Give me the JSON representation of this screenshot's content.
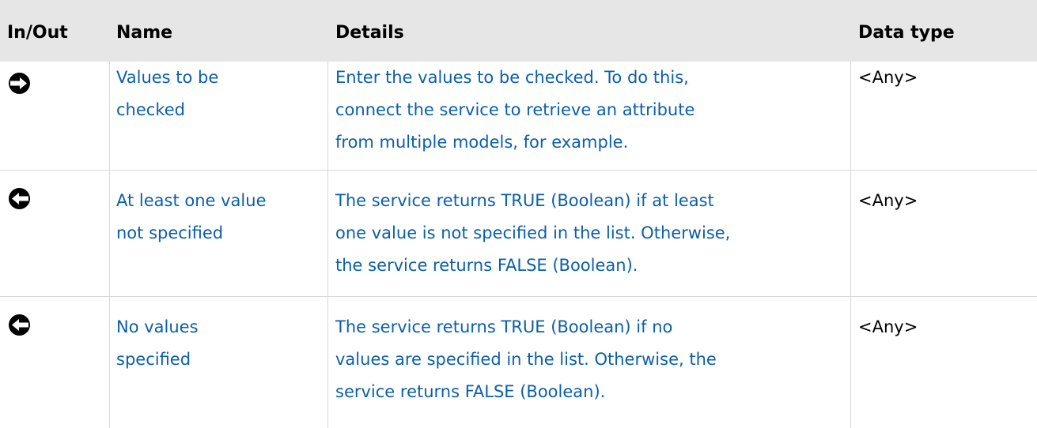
{
  "table": {
    "headers": {
      "inout": "In/Out",
      "name": "Name",
      "details": "Details",
      "datatype": "Data type"
    },
    "rows": [
      {
        "direction": "input",
        "icon": "input-arrow-icon",
        "name_line1": "Values to be",
        "name_line2": "checked",
        "details_line1": "Enter the values to be checked. To do this,",
        "details_line2": "connect the service to retrieve an attribute",
        "details_line3": "from multiple models, for example.",
        "datatype": "<Any>"
      },
      {
        "direction": "output",
        "icon": "output-arrow-icon",
        "name_line1": "At least one value",
        "name_line2": "not specified",
        "details_line1": "The service returns TRUE (Boolean) if at least",
        "details_line2": "one value is not specified in the list. Otherwise,",
        "details_line3": "the service returns FALSE (Boolean).",
        "datatype": "<Any>"
      },
      {
        "direction": "output",
        "icon": "output-arrow-icon",
        "name_line1": "No values",
        "name_line2": "specified",
        "details_line1": "The service returns TRUE (Boolean) if no",
        "details_line2": "values are specified in the list. Otherwise, the",
        "details_line3": "service returns FALSE (Boolean).",
        "datatype": "<Any>"
      }
    ]
  }
}
